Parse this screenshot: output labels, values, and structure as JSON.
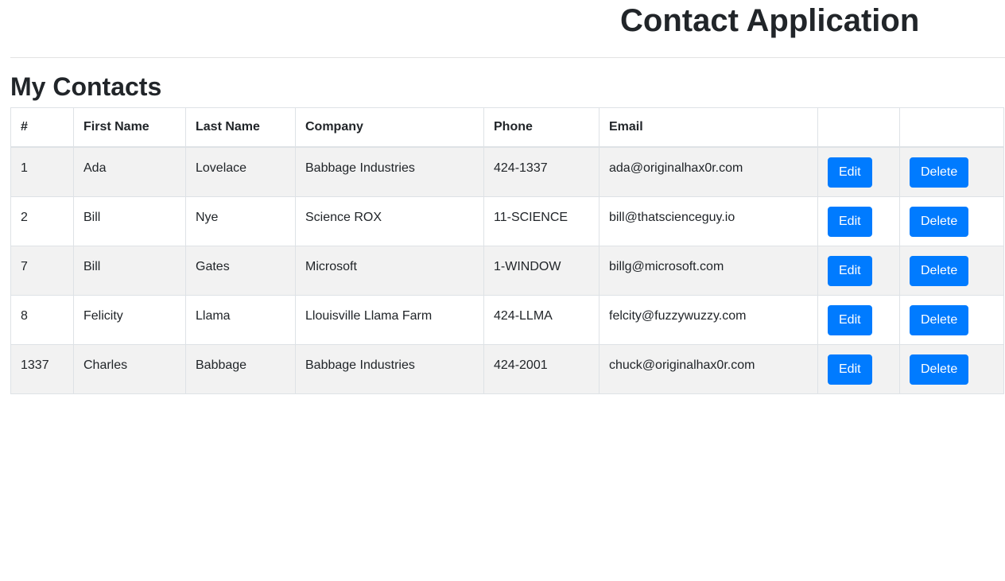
{
  "header": {
    "title": "Contact Application"
  },
  "section": {
    "title": "My Contacts"
  },
  "table": {
    "columns": [
      "#",
      "First Name",
      "Last Name",
      "Company",
      "Phone",
      "Email",
      "",
      ""
    ],
    "rows": [
      {
        "id": "1",
        "first_name": "Ada",
        "last_name": "Lovelace",
        "company": "Babbage Industries",
        "phone": "424-1337",
        "email": "ada@originalhax0r.com",
        "edit_label": "Edit",
        "delete_label": "Delete"
      },
      {
        "id": "2",
        "first_name": "Bill",
        "last_name": "Nye",
        "company": "Science ROX",
        "phone": "11-SCIENCE",
        "email": "bill@thatscienceguy.io",
        "edit_label": "Edit",
        "delete_label": "Delete"
      },
      {
        "id": "7",
        "first_name": "Bill",
        "last_name": "Gates",
        "company": "Microsoft",
        "phone": "1-WINDOW",
        "email": "billg@microsoft.com",
        "edit_label": "Edit",
        "delete_label": "Delete"
      },
      {
        "id": "8",
        "first_name": "Felicity",
        "last_name": "Llama",
        "company": "Llouisville Llama Farm",
        "phone": "424-LLMA",
        "email": "felcity@fuzzywuzzy.com",
        "edit_label": "Edit",
        "delete_label": "Delete"
      },
      {
        "id": "1337",
        "first_name": "Charles",
        "last_name": "Babbage",
        "company": "Babbage Industries",
        "phone": "424-2001",
        "email": "chuck@originalhax0r.com",
        "edit_label": "Edit",
        "delete_label": "Delete"
      }
    ]
  },
  "colors": {
    "primary_button": "#007bff",
    "striped_row": "#f2f2f2",
    "border": "#dee2e6",
    "text": "#212529"
  }
}
